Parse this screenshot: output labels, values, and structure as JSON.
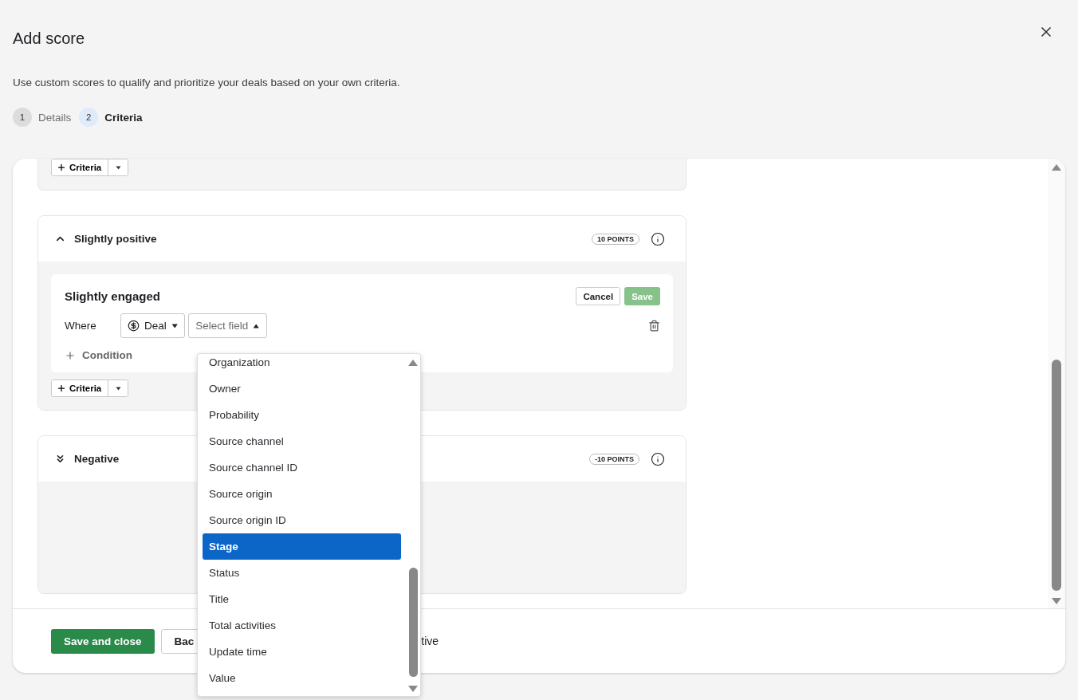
{
  "dialog": {
    "title": "Add score",
    "description": "Use custom scores to qualify and prioritize your deals based on your own criteria.",
    "steps": [
      {
        "number": "1",
        "label": "Details",
        "selected": false
      },
      {
        "number": "2",
        "label": "Criteria",
        "selected": true
      }
    ]
  },
  "sections": [
    {
      "kind": "partial",
      "criteria_button": "Criteria"
    },
    {
      "kind": "full",
      "title": "Slightly positive",
      "expanded": true,
      "points": "10 POINTS",
      "criterion": {
        "title": "Slightly engaged",
        "cancel": "Cancel",
        "save": "Save",
        "save_disabled": true,
        "where": "Where",
        "entity": "Deal",
        "field_placeholder": "Select field",
        "add_condition": "Condition"
      },
      "criteria_button": "Criteria"
    },
    {
      "kind": "full",
      "title": "Negative",
      "expanded": false,
      "points": "-10 POINTS"
    }
  ],
  "dropdown": {
    "options": [
      {
        "label": "Organization",
        "selected": false
      },
      {
        "label": "Owner",
        "selected": false
      },
      {
        "label": "Probability",
        "selected": false
      },
      {
        "label": "Source channel",
        "selected": false
      },
      {
        "label": "Source channel ID",
        "selected": false
      },
      {
        "label": "Source origin",
        "selected": false
      },
      {
        "label": "Source origin ID",
        "selected": false
      },
      {
        "label": "Stage",
        "selected": true
      },
      {
        "label": "Status",
        "selected": false
      },
      {
        "label": "Title",
        "selected": false
      },
      {
        "label": "Total activities",
        "selected": false
      },
      {
        "label": "Update time",
        "selected": false
      },
      {
        "label": "Value",
        "selected": false
      }
    ]
  },
  "footer": {
    "save": "Save and close",
    "back": "Bac",
    "note": "tive"
  }
}
